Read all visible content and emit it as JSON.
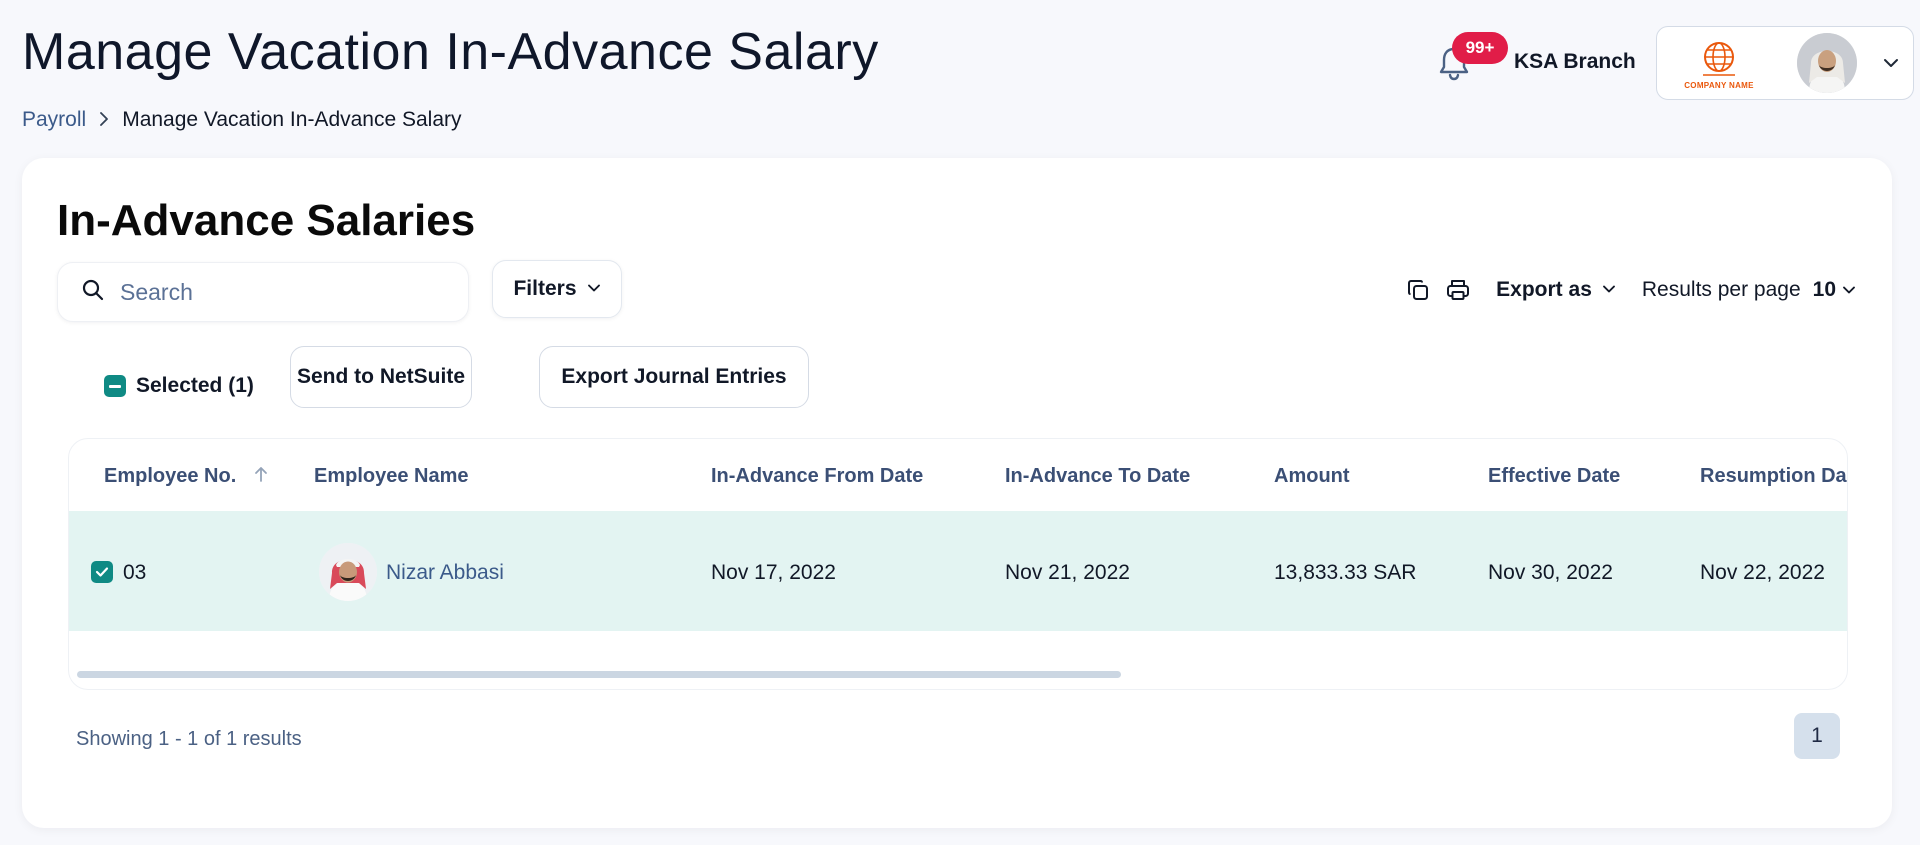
{
  "header": {
    "title": "Manage Vacation In-Advance Salary",
    "breadcrumb": {
      "parent": "Payroll",
      "current": "Manage Vacation In-Advance Salary"
    },
    "notification_badge": "99+",
    "branch": "KSA Branch",
    "company_logo_text": "COMPANY NAME"
  },
  "card": {
    "title": "In-Advance Salaries",
    "search": {
      "placeholder": "Search",
      "value": ""
    },
    "filters_label": "Filters",
    "export_label": "Export as",
    "results_per_page_label": "Results per page",
    "results_per_page_value": "10",
    "selected_label": "Selected (1)",
    "send_netsuite_label": "Send to NetSuite",
    "export_journal_label": "Export Journal Entries"
  },
  "table": {
    "columns": [
      "Employee No.",
      "Employee Name",
      "In-Advance From Date",
      "In-Advance To Date",
      "Amount",
      "Effective Date",
      "Resumption Da"
    ],
    "rows": [
      {
        "employee_no": "03",
        "employee_name": "Nizar Abbasi",
        "from_date": "Nov 17, 2022",
        "to_date": "Nov 21, 2022",
        "amount": "13,833.33 SAR",
        "effective_date": "Nov 30, 2022",
        "resumption_date": "Nov 22, 2022",
        "selected": true
      }
    ]
  },
  "pagination": {
    "showing": "Showing 1 - 1 of 1 results",
    "current_page": "1"
  },
  "colors": {
    "accent": "#0f8a84",
    "selected_row": "#e3f4f2",
    "badge": "#e11d48",
    "link": "#3b5a8a"
  }
}
